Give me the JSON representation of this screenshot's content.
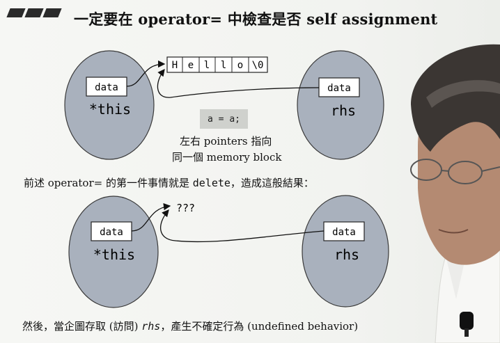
{
  "title": "一定要在 operator= 中檢查是否 self assignment",
  "top_diagram": {
    "left_object": {
      "field": "data",
      "name": "*this"
    },
    "right_object": {
      "field": "data",
      "name": "rhs"
    },
    "string_cells": [
      "H",
      "e",
      "l",
      "l",
      "o",
      "\\0"
    ],
    "statement": "a = a;",
    "caption_line1": "左右 pointers 指向",
    "caption_line2": "同一個 memory block"
  },
  "middle_note": {
    "prefix": "前述 operator= 的第一件事情就是 ",
    "code": "delete",
    "suffix": "，造成這般結果："
  },
  "bottom_diagram": {
    "left_object": {
      "field": "data",
      "name": "*this"
    },
    "right_object": {
      "field": "data",
      "name": "rhs"
    },
    "unknown_target": "???"
  },
  "bottom_note": {
    "prefix": "然後，當企圖存取 (訪問) ",
    "code": "rhs",
    "suffix": "，產生不確定行為 (undefined behavior)"
  },
  "colors": {
    "ellipse_fill": "#a9b1bd",
    "ellipse_stroke": "#3a3a3a",
    "statement_bg": "#cfd1cd"
  }
}
